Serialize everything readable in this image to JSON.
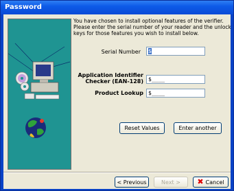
{
  "window": {
    "title": "Password"
  },
  "intro_text": "You have chosen to install optional features of the verifier. Please enter the serial number of your reader and the unlock keys for those features you wish to install below.",
  "fields": {
    "serial": {
      "label": "Serial Number",
      "value": "$"
    },
    "app_id": {
      "label_line1": "Application Identifier",
      "label_line2": "Checker (EAN-128)",
      "value": "$____"
    },
    "product": {
      "label": "Product Lookup",
      "value": "$____"
    }
  },
  "buttons": {
    "reset": "Reset Values",
    "enter_another": "Enter another",
    "previous": "< Previous",
    "next": "Next >",
    "cancel": "Cancel"
  },
  "colors": {
    "banner": "#1f9492",
    "titlebar": "#0a4ad6",
    "selection": "#316ac5"
  },
  "icons": [
    "computer-icon",
    "cd-icon",
    "globe-icon",
    "cancel-x-icon"
  ]
}
